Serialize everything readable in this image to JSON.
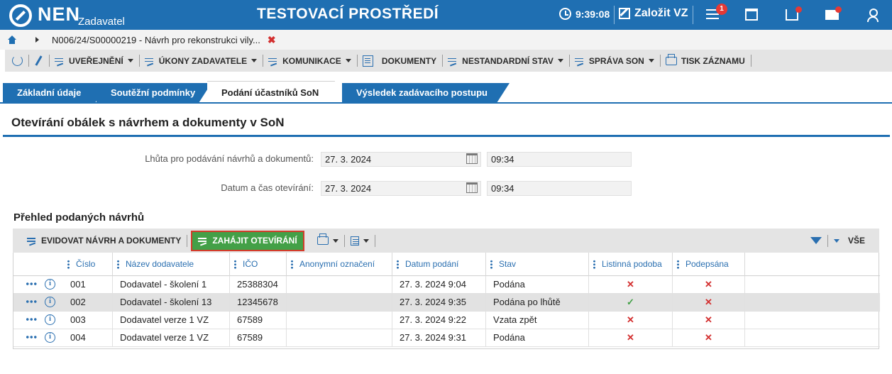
{
  "header": {
    "logo": "NEN",
    "logo_sub": "Zadavatel",
    "env_title": "TESTOVACÍ PROSTŘEDÍ",
    "time": "9:39:08",
    "create_label": "Založit VZ",
    "notif_count": "1",
    "icons": [
      "clock-icon",
      "edit-icon",
      "menu-icon",
      "calendar-icon",
      "inbox-icon",
      "mail-icon",
      "user-icon"
    ]
  },
  "breadcrumb": {
    "text": "N006/24/S00000219 - Návrh pro rekonstrukci vily...",
    "close": "✖"
  },
  "toolbar": {
    "items": [
      "UVEŘEJNĚNÍ",
      "ÚKONY ZADAVATELE",
      "KOMUNIKACE",
      "DOKUMENTY",
      "NESTANDARDNÍ STAV",
      "SPRÁVA SON",
      "TISK ZÁZNAMU"
    ]
  },
  "tabs": [
    "Základní údaje",
    "Soutěžní podmínky",
    "Podání účastníků SoN",
    "Výsledek zadávacího postupu"
  ],
  "section": {
    "title": "Otevírání obálek s návrhem a dokumenty v SoN"
  },
  "form": {
    "deadline_label": "Lhůta pro podávání návrhů a dokumentů:",
    "deadline_date": "27. 3. 2024",
    "deadline_time": "09:34",
    "opening_label": "Datum a čas otevírání:",
    "opening_date": "27. 3. 2024",
    "opening_time": "09:34"
  },
  "list": {
    "title": "Přehled podaných návrhů",
    "record_btn": "EVIDOVAT NÁVRH A DOKUMENTY",
    "start_btn": "ZAHÁJIT OTEVÍRÁNÍ",
    "all_label": "VŠE",
    "columns": [
      "Číslo",
      "Název dodavatele",
      "IČO",
      "Anonymní označení",
      "Datum podání",
      "Stav",
      "Listinná podoba",
      "Podepsána"
    ],
    "rows": [
      {
        "cislo": "001",
        "nazev": "Dodavatel - školení 1",
        "ico": "25388304",
        "anon": "",
        "datum": "27. 3. 2024 9:04",
        "stav": "Podána",
        "listinna": "✕",
        "podepsana": "✕"
      },
      {
        "cislo": "002",
        "nazev": "Dodavatel - školení 13",
        "ico": "12345678",
        "anon": "",
        "datum": "27. 3. 2024 9:35",
        "stav": "Podána po lhůtě",
        "listinna": "✓",
        "podepsana": "✕"
      },
      {
        "cislo": "003",
        "nazev": "Dodavatel verze 1 VZ",
        "ico": "67589",
        "anon": "",
        "datum": "27. 3. 2024 9:22",
        "stav": "Vzata zpět",
        "listinna": "✕",
        "podepsana": "✕"
      },
      {
        "cislo": "004",
        "nazev": "Dodavatel verze 1 VZ",
        "ico": "67589",
        "anon": "",
        "datum": "27. 3. 2024 9:31",
        "stav": "Podána",
        "listinna": "✕",
        "podepsana": "✕"
      }
    ]
  },
  "colors": {
    "brand_blue": "#1f6fb2",
    "start_green": "#43a047",
    "alert_red": "#d32f2f"
  }
}
